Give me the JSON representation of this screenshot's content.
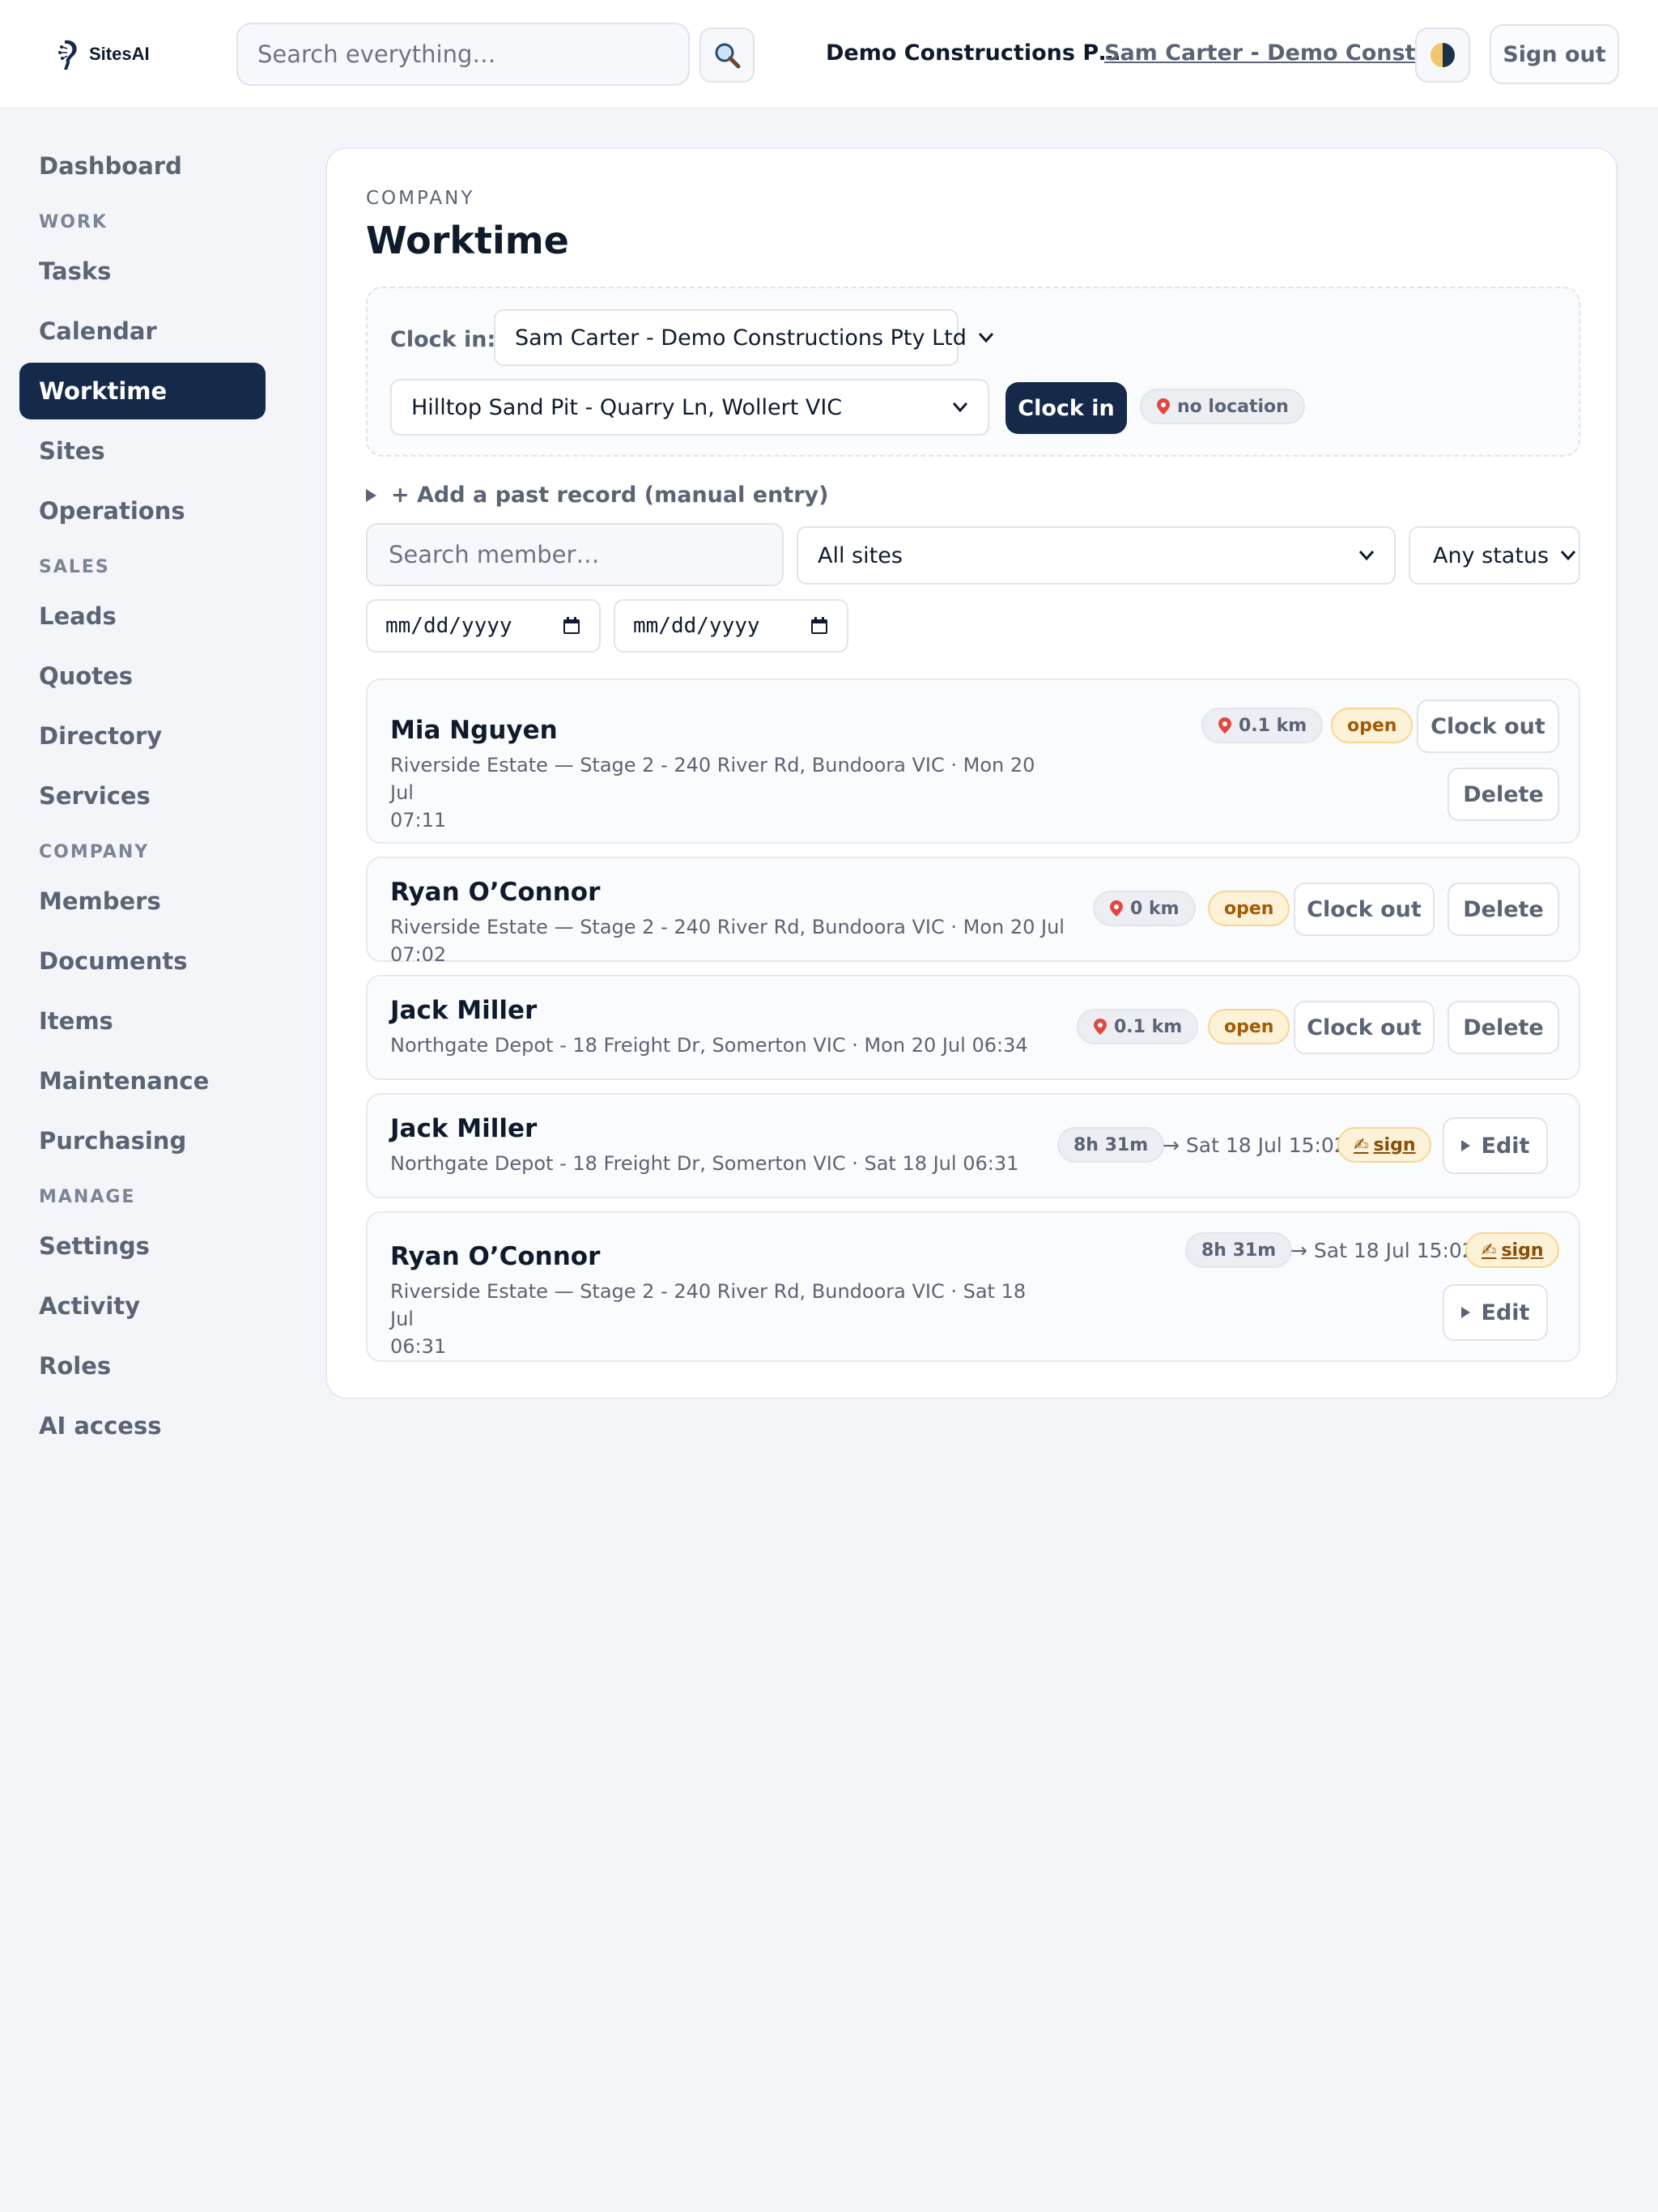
{
  "brand": {
    "name": "SitesAI"
  },
  "header": {
    "search_placeholder": "Search everything…",
    "company": "Demo Constructions P…",
    "user": "Sam Carter - Demo Constr…",
    "signout_label": "Sign out"
  },
  "sidebar": {
    "items": [
      {
        "label": "Dashboard"
      },
      {
        "section": "WORK"
      },
      {
        "label": "Tasks"
      },
      {
        "label": "Calendar"
      },
      {
        "label": "Worktime",
        "active": true
      },
      {
        "label": "Sites"
      },
      {
        "label": "Operations"
      },
      {
        "section": "SALES"
      },
      {
        "label": "Leads"
      },
      {
        "label": "Quotes"
      },
      {
        "label": "Directory"
      },
      {
        "label": "Services"
      },
      {
        "section": "COMPANY"
      },
      {
        "label": "Members"
      },
      {
        "label": "Documents"
      },
      {
        "label": "Items"
      },
      {
        "label": "Maintenance"
      },
      {
        "label": "Purchasing"
      },
      {
        "section": "MANAGE"
      },
      {
        "label": "Settings"
      },
      {
        "label": "Activity"
      },
      {
        "label": "Roles"
      },
      {
        "label": "AI access"
      }
    ]
  },
  "page": {
    "eyebrow": "COMPANY",
    "title": "Worktime"
  },
  "clock": {
    "label": "Clock in:",
    "member_selected": "Sam Carter - Demo Constructions Pty Ltd",
    "site_selected": "Hilltop Sand Pit - Quarry Ln, Wollert VIC",
    "button_label": "Clock in",
    "location_status": "no location"
  },
  "manual_entry_label": "+ Add a past record (manual entry)",
  "filters": {
    "member_placeholder": "Search member…",
    "site_selected": "All sites",
    "status_selected": "Any status",
    "date_from": "mm/dd/yyyy",
    "date_to": "mm/dd/yyyy"
  },
  "records": [
    {
      "name": "Mia Nguyen",
      "detail_line1": "Riverside Estate — Stage 2 - 240 River Rd, Bundoora VIC · Mon 20 Jul",
      "detail_line2": "07:11",
      "distance": "0.1 km",
      "status": "open",
      "clock_out_label": "Clock out",
      "delete_label": "Delete"
    },
    {
      "name": "Ryan O’Connor",
      "detail_line1": "Riverside Estate — Stage 2 - 240 River Rd, Bundoora VIC · Mon 20 Jul 07:02",
      "distance": "0 km",
      "status": "open",
      "clock_out_label": "Clock out",
      "delete_label": "Delete"
    },
    {
      "name": "Jack Miller",
      "detail_line1": "Northgate Depot - 18 Freight Dr, Somerton VIC · Mon 20 Jul 06:34",
      "distance": "0.1 km",
      "status": "open",
      "clock_out_label": "Clock out",
      "delete_label": "Delete"
    },
    {
      "name": "Jack Miller",
      "detail_line1": "Northgate Depot - 18 Freight Dr, Somerton VIC · Sat 18 Jul 06:31",
      "duration": "8h 31m",
      "end_time": "→ Sat 18 Jul 15:02",
      "sign_label": "sign",
      "edit_label": "Edit"
    },
    {
      "name": "Ryan O’Connor",
      "detail_line1": "Riverside Estate — Stage 2 - 240 River Rd, Bundoora VIC · Sat 18 Jul",
      "detail_line2": "06:31",
      "duration": "8h 31m",
      "end_time": "→ Sat 18 Jul 15:02",
      "sign_label": "sign",
      "edit_label": "Edit"
    }
  ],
  "icons": {
    "search": "magnifier-icon",
    "theme": "half-moon-icon",
    "location": "pin-icon",
    "sign": "writing-hand-icon"
  },
  "colors": {
    "primary": "#15294b",
    "open_badge_bg": "#fdf1d8",
    "open_badge_text": "#a15c06",
    "muted_text": "#5b6474"
  }
}
